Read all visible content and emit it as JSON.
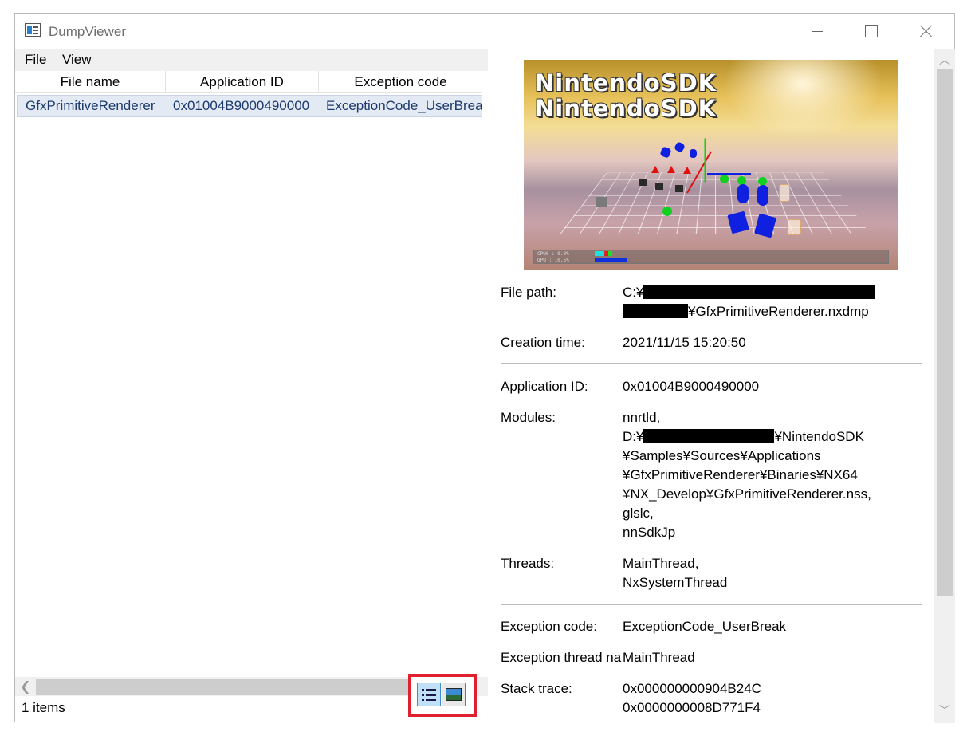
{
  "window": {
    "title": "DumpViewer"
  },
  "menu": {
    "file": "File",
    "view": "View"
  },
  "list": {
    "columns": [
      "File name",
      "Application ID",
      "Exception code"
    ],
    "rows": [
      {
        "file_name": "GfxPrimitiveRenderer",
        "application_id": "0x01004B9000490000",
        "exception_code": "ExceptionCode_UserBreak"
      }
    ]
  },
  "status": {
    "count": "1 items"
  },
  "screenshot": {
    "logo_line1": "NintendoSDK",
    "logo_line2": "NintendoSDK",
    "bar_cpu": "CPU0  :  0.0%",
    "bar_gpu": "GPU   : 10.5%"
  },
  "details": {
    "file_path_label": "File path:",
    "file_path_prefix": "C:¥",
    "file_path_suffix": "¥GfxPrimitiveRenderer.nxdmp",
    "creation_time_label": "Creation time:",
    "creation_time": "2021/11/15 15:20:50",
    "application_id_label": "Application ID:",
    "application_id": "0x01004B9000490000",
    "modules_label": "Modules:",
    "modules": {
      "line1": "nnrtld,",
      "line2_prefix": "D:¥",
      "line2_suffix": "¥NintendoSDK",
      "line3": "¥Samples¥Sources¥Applications",
      "line4": "¥GfxPrimitiveRenderer¥Binaries¥NX64",
      "line5": "¥NX_Develop¥GfxPrimitiveRenderer.nss,",
      "line6": "glslc,",
      "line7": "nnSdkJp"
    },
    "threads_label": "Threads:",
    "threads": [
      "MainThread,",
      "NxSystemThread"
    ],
    "exception_code_label": "Exception code:",
    "exception_code": "ExceptionCode_UserBreak",
    "exception_thread_label": "Exception thread name:",
    "exception_thread": "MainThread",
    "stack_trace_label": "Stack trace:",
    "stack_trace": [
      "0x000000000904B24C",
      "0x0000000008D771F4"
    ]
  },
  "icons": {
    "app": "app-window-icon",
    "minimize": "minimize-icon",
    "maximize": "maximize-icon",
    "close": "close-icon",
    "list_view": "list-view-icon",
    "image_view": "image-view-icon"
  },
  "colors": {
    "selection": "#e4eaf3",
    "highlight_border": "#e0202e",
    "link_text": "#1c3a6e"
  }
}
